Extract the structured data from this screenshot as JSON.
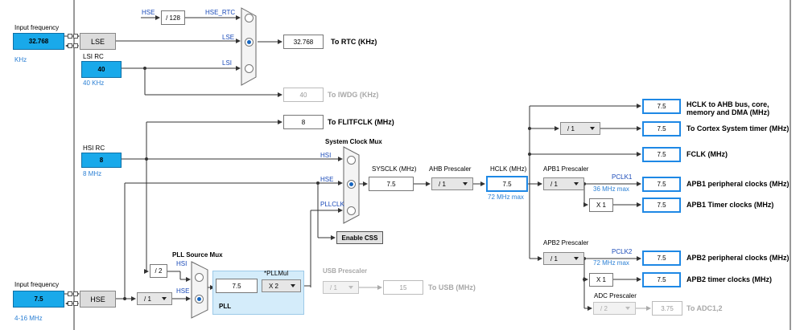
{
  "inputs": {
    "lse_title": "Input frequency",
    "lse_value": "32.768",
    "lse_unit": "KHz",
    "hse_title": "Input frequency",
    "hse_value": "7.5",
    "hse_range": "4-16 MHz"
  },
  "oscillators": {
    "lse": "LSE",
    "lsi_title": "LSI RC",
    "lsi_value": "40",
    "lsi_unit": "40 KHz",
    "hsi_title": "HSI RC",
    "hsi_value": "8",
    "hsi_unit": "8 MHz",
    "hse": "HSE"
  },
  "rtc": {
    "hse_label": "HSE",
    "div_value": "/ 128",
    "hse_rtc_label": "HSE_RTC",
    "lse_label": "LSE",
    "lsi_label": "LSI",
    "out_value": "32.768",
    "out_label": "To RTC (KHz)"
  },
  "iwdg": {
    "value": "40",
    "label": "To IWDG (KHz)"
  },
  "flitf": {
    "value": "8",
    "label": "To FLITFCLK (MHz)"
  },
  "sysmux": {
    "title": "System Clock Mux",
    "hsi": "HSI",
    "hse": "HSE",
    "pllclk": "PLLCLK",
    "enable_css": "Enable CSS"
  },
  "sysclk": {
    "label": "SYSCLK (MHz)",
    "value": "7.5"
  },
  "ahb": {
    "label": "AHB Prescaler",
    "value": "/ 1"
  },
  "hclk": {
    "label": "HCLK (MHz)",
    "value": "7.5",
    "max": "72 MHz max"
  },
  "outputs": {
    "hclk_ahb_value": "7.5",
    "hclk_ahb_label1": "HCLK to AHB bus, core,",
    "hclk_ahb_label2": "memory and DMA (MHz)",
    "cortex_div": "/ 1",
    "cortex_value": "7.5",
    "cortex_label": "To Cortex System timer (MHz)",
    "fclk_value": "7.5",
    "fclk_label": "FCLK (MHz)"
  },
  "apb1": {
    "prescaler_label": "APB1 Prescaler",
    "prescaler_value": "/ 1",
    "pclk": "PCLK1",
    "max": "36 MHz max",
    "periph_value": "7.5",
    "periph_label": "APB1 peripheral clocks (MHz)",
    "timer_mult": "X 1",
    "timer_value": "7.5",
    "timer_label": "APB1 Timer clocks (MHz)"
  },
  "apb2": {
    "prescaler_label": "APB2 Prescaler",
    "prescaler_value": "/ 1",
    "pclk": "PCLK2",
    "max": "72 MHz max",
    "periph_value": "7.5",
    "periph_label": "APB2 peripheral clocks (MHz)",
    "timer_mult": "X 1",
    "timer_value": "7.5",
    "timer_label": "APB2 timer clocks (MHz)",
    "adc_label": "ADC Prescaler",
    "adc_value": "/ 2",
    "adc_out": "3.75",
    "adc_out_label": "To ADC1,2"
  },
  "pll": {
    "src_title": "PLL Source Mux",
    "div2": "/ 2",
    "hsi": "HSI",
    "hse": "HSE",
    "hse_div": "/ 1",
    "mul_label": "*PLLMul",
    "value": "7.5",
    "mul": "X 2",
    "pll_label": "PLL"
  },
  "usb": {
    "label": "USB Prescaler",
    "value": "/ 1",
    "out": "15",
    "out_label": "To USB (MHz)"
  },
  "colors": {
    "input_blue": "#19a9ea",
    "accent_border": "#1e88e5",
    "pll_fill": "#d4ecfa",
    "label_blue": "#1a4ab8"
  }
}
